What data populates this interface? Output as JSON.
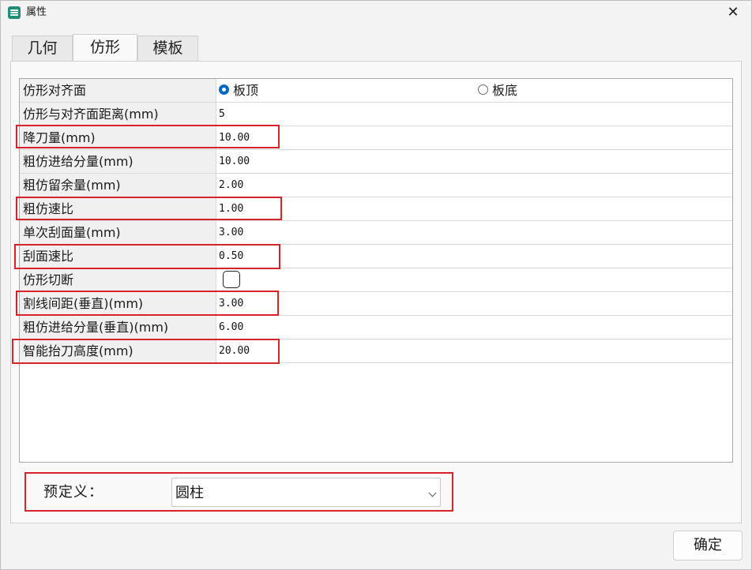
{
  "window": {
    "title": "属性",
    "close_glyph": "✕",
    "app_icon": "properties-app-icon"
  },
  "tabs": [
    {
      "label": "几何",
      "active": false
    },
    {
      "label": "仿形",
      "active": true
    },
    {
      "label": "模板",
      "active": false
    }
  ],
  "properties": [
    {
      "label": "仿形对齐面",
      "type": "radio",
      "options": [
        "板顶",
        "板底"
      ],
      "selected": "板顶"
    },
    {
      "label": "仿形与对齐面距离(mm)",
      "value": "5"
    },
    {
      "label": "降刀量(mm)",
      "value": "10.00",
      "highlighted": true
    },
    {
      "label": "粗仿进给分量(mm)",
      "value": "10.00"
    },
    {
      "label": "粗仿留余量(mm)",
      "value": "2.00"
    },
    {
      "label": "粗仿速比",
      "value": "1.00",
      "highlighted": true
    },
    {
      "label": "单次刮面量(mm)",
      "value": "3.00"
    },
    {
      "label": "刮面速比",
      "value": "0.50",
      "highlighted": true
    },
    {
      "label": "仿形切断",
      "type": "checkbox",
      "checked": false
    },
    {
      "label": "割线间距(垂直)(mm)",
      "value": "3.00",
      "highlighted": true
    },
    {
      "label": "粗仿进给分量(垂直)(mm)",
      "value": "6.00"
    },
    {
      "label": "智能抬刀高度(mm)",
      "value": "20.00",
      "highlighted": true
    }
  ],
  "predefined": {
    "label": "预定义：",
    "value": "圆柱",
    "highlighted": true
  },
  "buttons": {
    "ok": "确定"
  },
  "colors": {
    "highlight": "#d8232a",
    "radio_accent": "#0067c0"
  }
}
